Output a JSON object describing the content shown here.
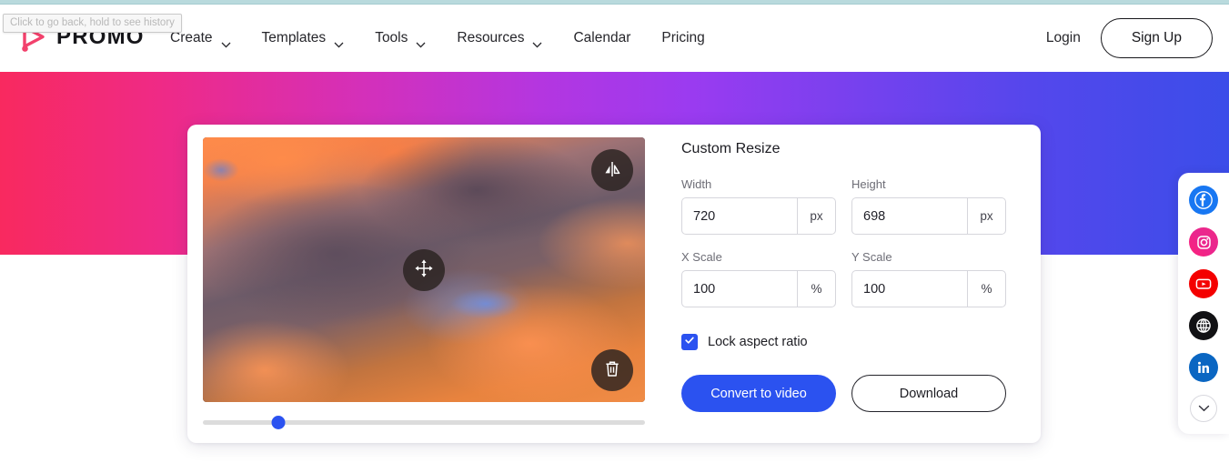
{
  "brand": {
    "name": "PROMO",
    "logo_icon": "play-triangle-icon",
    "logo_color": "#f2416c"
  },
  "tooltip": {
    "back_hint": "Click to go back, hold to see history"
  },
  "nav": {
    "items": [
      {
        "label": "Create",
        "has_dropdown": true,
        "icon": "chevron-down-icon"
      },
      {
        "label": "Templates",
        "has_dropdown": true,
        "icon": "chevron-down-icon"
      },
      {
        "label": "Tools",
        "has_dropdown": true,
        "icon": "chevron-down-icon"
      },
      {
        "label": "Resources",
        "has_dropdown": true,
        "icon": "chevron-down-icon"
      },
      {
        "label": "Calendar",
        "has_dropdown": false
      },
      {
        "label": "Pricing",
        "has_dropdown": false
      }
    ],
    "login_label": "Login",
    "signup_label": "Sign Up"
  },
  "hero": {
    "gradient_start": "#f8295f",
    "gradient_mid": "#9b3bf0",
    "gradient_end": "#3b4de9"
  },
  "preview": {
    "image_description": "sunset-clouds-photo",
    "flip_icon": "flip-horizontal-icon",
    "move_icon": "move-arrows-icon",
    "delete_icon": "trash-icon",
    "slider_value_percent": 17
  },
  "panel": {
    "title": "Custom Resize",
    "fields": [
      {
        "label": "Width",
        "value": "720",
        "unit": "px",
        "name": "width"
      },
      {
        "label": "Height",
        "value": "698",
        "unit": "px",
        "name": "height"
      },
      {
        "label": "X Scale",
        "value": "100",
        "unit": "%",
        "name": "x-scale"
      },
      {
        "label": "Y Scale",
        "value": "100",
        "unit": "%",
        "name": "y-scale"
      }
    ],
    "lock_aspect_label": "Lock aspect ratio",
    "lock_aspect_checked": true,
    "check_icon": "check-icon",
    "primary_button": "Convert to video",
    "secondary_button": "Download",
    "accent_color": "#2b52f0"
  },
  "social_rail": {
    "items": [
      {
        "name": "facebook",
        "icon": "facebook-icon",
        "color": "#1877f2"
      },
      {
        "name": "instagram",
        "icon": "instagram-icon",
        "color": "#e9268f"
      },
      {
        "name": "youtube",
        "icon": "youtube-icon",
        "color": "#f40000"
      },
      {
        "name": "website",
        "icon": "globe-icon",
        "color": "#111114"
      },
      {
        "name": "linkedin",
        "icon": "linkedin-icon",
        "color": "#0a66c2"
      }
    ],
    "toggle_icon": "chevron-down-icon"
  }
}
